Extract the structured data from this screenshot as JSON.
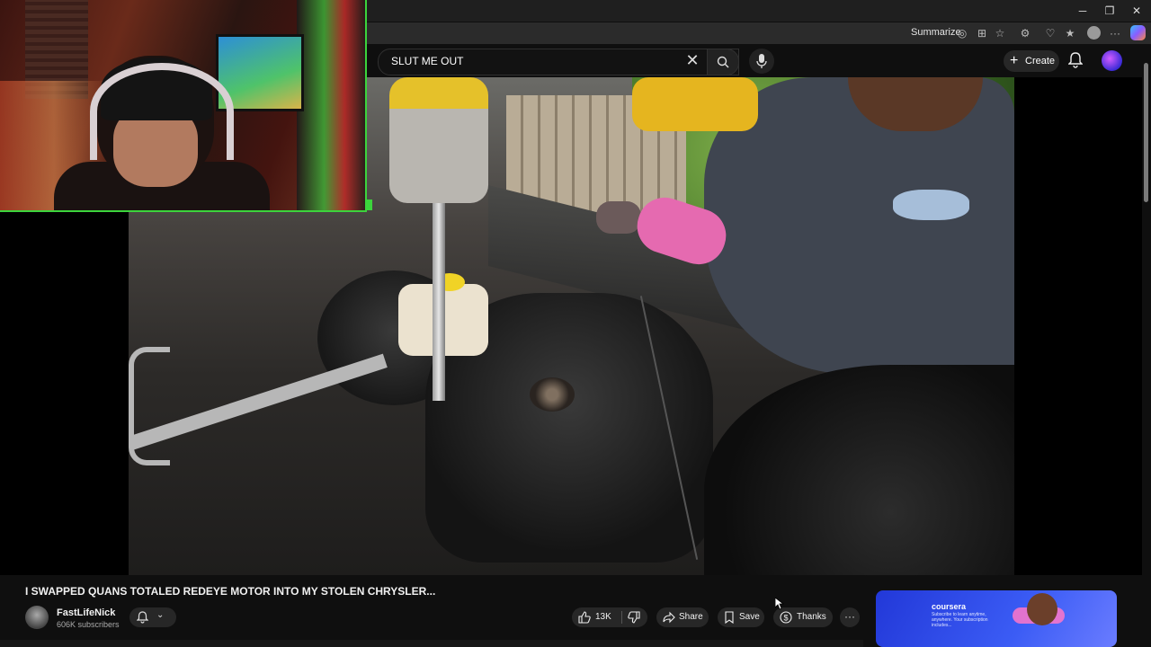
{
  "browser": {
    "summarize_label": "Summarize",
    "window_controls": [
      "─",
      "❐",
      "✕"
    ]
  },
  "header": {
    "search_query": "SLUT ME OUT",
    "create_label": "Create"
  },
  "video": {
    "title": "I SWAPPED QUANS TOTALED REDEYE MOTOR INTO MY STOLEN CHRYSLER..."
  },
  "channel": {
    "name": "FastLifeNick",
    "subscribers": "606K subscribers"
  },
  "actions": {
    "like_count": "13K",
    "share_label": "Share",
    "save_label": "Save",
    "thanks_label": "Thanks",
    "more_label": "···"
  },
  "ad": {
    "brand": "coursera",
    "tagline": "Subscribe to learn anytime, anywhere. Your subscription includes..."
  },
  "colors": {
    "background": "#0f0f0f",
    "webcam_border": "#3cd43c",
    "ad_blue": "#2238d8"
  }
}
